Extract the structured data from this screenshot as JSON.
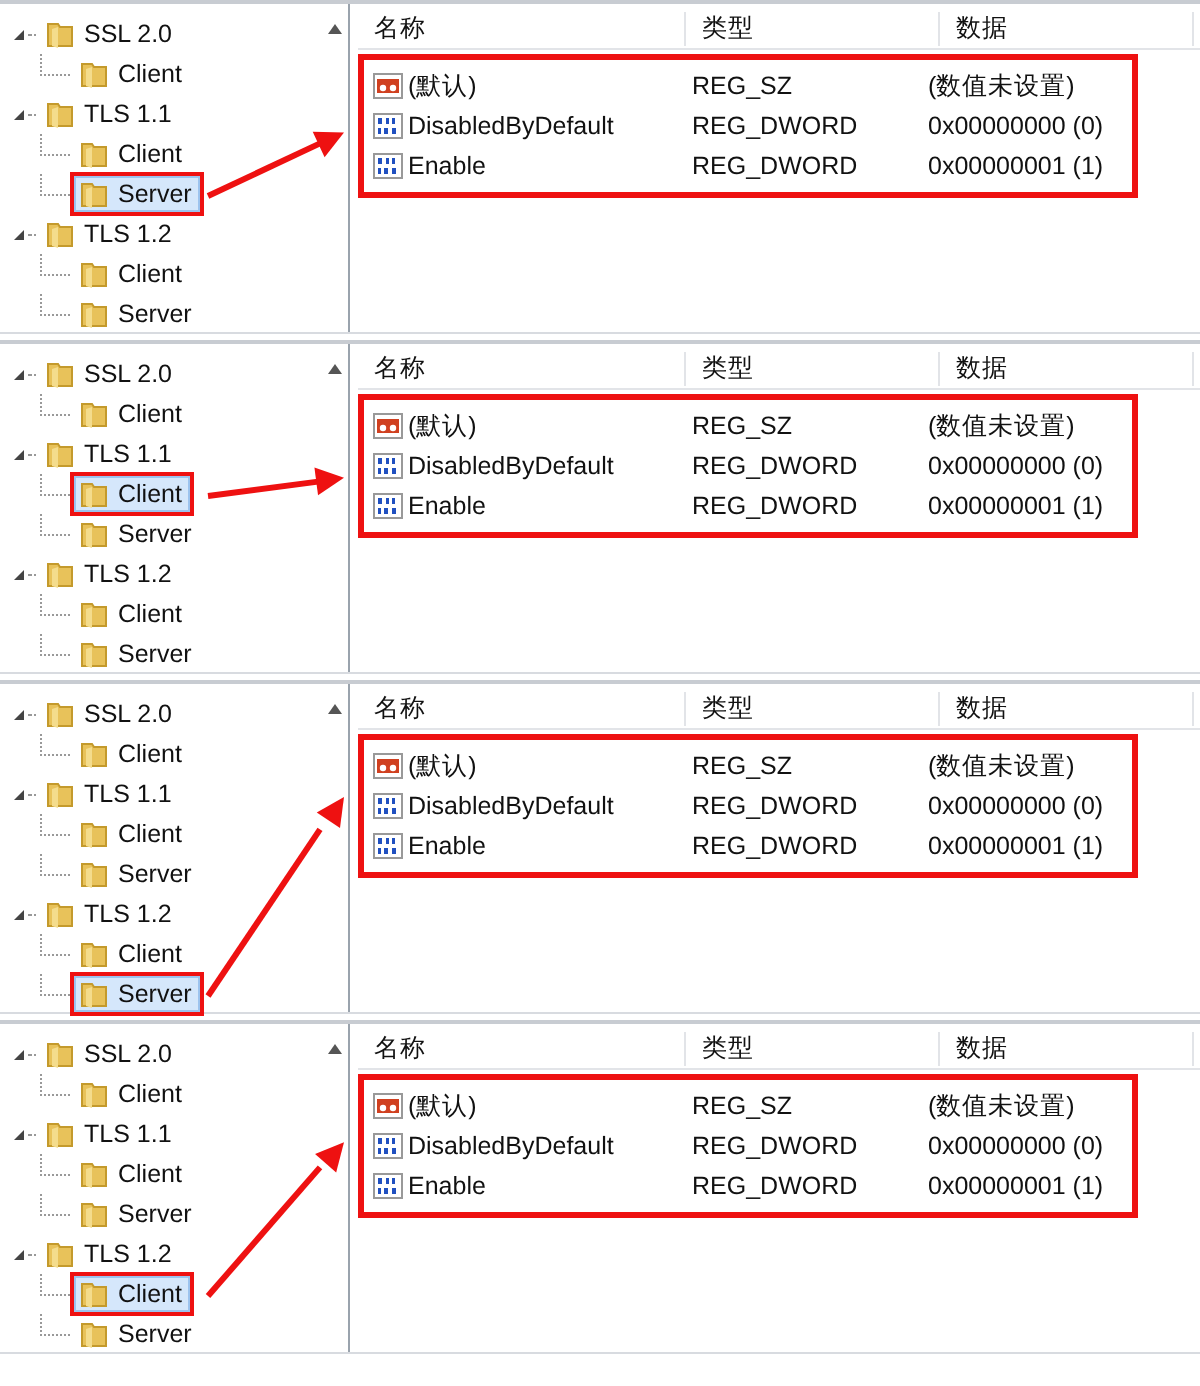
{
  "panels": [
    {
      "tree": [
        {
          "label": "SSL 2.0",
          "expanded": true,
          "selected": false,
          "children": [
            {
              "label": "Client",
              "selected": false
            }
          ]
        },
        {
          "label": "TLS 1.1",
          "expanded": true,
          "selected": false,
          "children": [
            {
              "label": "Client",
              "selected": false
            },
            {
              "label": "Server",
              "selected": true
            }
          ]
        },
        {
          "label": "TLS 1.2",
          "expanded": true,
          "selected": false,
          "children": [
            {
              "label": "Client",
              "selected": false
            },
            {
              "label": "Server",
              "selected": false
            }
          ]
        }
      ],
      "columns": [
        "名称",
        "类型",
        "数据"
      ],
      "values": [
        {
          "kind": "string",
          "name": "(默认)",
          "type": "REG_SZ",
          "data": "(数值未设置)"
        },
        {
          "kind": "dword",
          "name": "DisabledByDefault",
          "type": "REG_DWORD",
          "data": "0x00000000 (0)"
        },
        {
          "kind": "dword",
          "name": "Enable",
          "type": "REG_DWORD",
          "data": "0x00000001 (1)"
        }
      ]
    },
    {
      "tree": [
        {
          "label": "SSL 2.0",
          "expanded": true,
          "selected": false,
          "children": [
            {
              "label": "Client",
              "selected": false
            }
          ]
        },
        {
          "label": "TLS 1.1",
          "expanded": true,
          "selected": false,
          "children": [
            {
              "label": "Client",
              "selected": true
            },
            {
              "label": "Server",
              "selected": false
            }
          ]
        },
        {
          "label": "TLS 1.2",
          "expanded": true,
          "selected": false,
          "children": [
            {
              "label": "Client",
              "selected": false
            },
            {
              "label": "Server",
              "selected": false
            }
          ]
        }
      ],
      "columns": [
        "名称",
        "类型",
        "数据"
      ],
      "values": [
        {
          "kind": "string",
          "name": "(默认)",
          "type": "REG_SZ",
          "data": "(数值未设置)"
        },
        {
          "kind": "dword",
          "name": "DisabledByDefault",
          "type": "REG_DWORD",
          "data": "0x00000000 (0)"
        },
        {
          "kind": "dword",
          "name": "Enable",
          "type": "REG_DWORD",
          "data": "0x00000001 (1)"
        }
      ]
    },
    {
      "tree": [
        {
          "label": "SSL 2.0",
          "expanded": true,
          "selected": false,
          "children": [
            {
              "label": "Client",
              "selected": false
            }
          ]
        },
        {
          "label": "TLS 1.1",
          "expanded": true,
          "selected": false,
          "children": [
            {
              "label": "Client",
              "selected": false
            },
            {
              "label": "Server",
              "selected": false
            }
          ]
        },
        {
          "label": "TLS 1.2",
          "expanded": true,
          "selected": false,
          "children": [
            {
              "label": "Client",
              "selected": false
            },
            {
              "label": "Server",
              "selected": true
            }
          ]
        }
      ],
      "columns": [
        "名称",
        "类型",
        "数据"
      ],
      "values": [
        {
          "kind": "string",
          "name": "(默认)",
          "type": "REG_SZ",
          "data": "(数值未设置)"
        },
        {
          "kind": "dword",
          "name": "DisabledByDefault",
          "type": "REG_DWORD",
          "data": "0x00000000 (0)"
        },
        {
          "kind": "dword",
          "name": "Enable",
          "type": "REG_DWORD",
          "data": "0x00000001 (1)"
        }
      ]
    },
    {
      "tree": [
        {
          "label": "SSL 2.0",
          "expanded": true,
          "selected": false,
          "children": [
            {
              "label": "Client",
              "selected": false
            }
          ]
        },
        {
          "label": "TLS 1.1",
          "expanded": true,
          "selected": false,
          "children": [
            {
              "label": "Client",
              "selected": false
            },
            {
              "label": "Server",
              "selected": false
            }
          ]
        },
        {
          "label": "TLS 1.2",
          "expanded": true,
          "selected": false,
          "children": [
            {
              "label": "Client",
              "selected": true
            },
            {
              "label": "Server",
              "selected": false
            }
          ]
        }
      ],
      "columns": [
        "名称",
        "类型",
        "数据"
      ],
      "values": [
        {
          "kind": "string",
          "name": "(默认)",
          "type": "REG_SZ",
          "data": "(数值未设置)"
        },
        {
          "kind": "dword",
          "name": "DisabledByDefault",
          "type": "REG_DWORD",
          "data": "0x00000000 (0)"
        },
        {
          "kind": "dword",
          "name": "Enable",
          "type": "REG_DWORD",
          "data": "0x00000001 (1)"
        }
      ]
    }
  ]
}
